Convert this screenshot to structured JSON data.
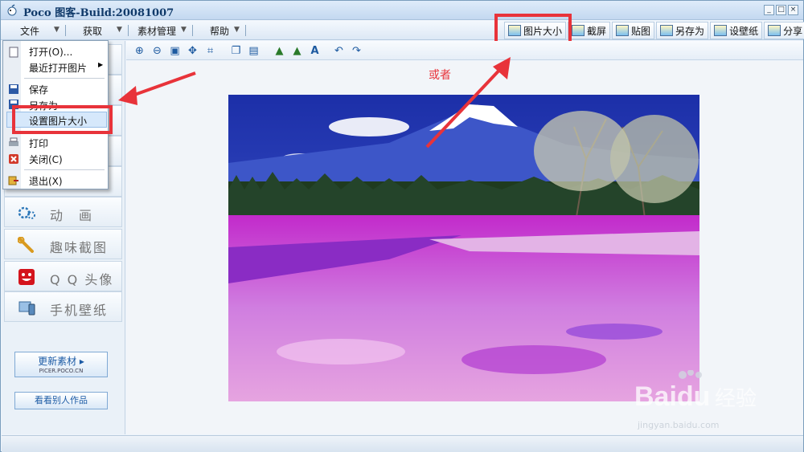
{
  "window": {
    "title": "Poco 图客-Build:20081007",
    "controls": [
      "_",
      "□",
      "×"
    ]
  },
  "menubar": {
    "items": [
      "文件",
      "获取",
      "素材管理",
      "帮助"
    ]
  },
  "toolbar_right": {
    "buttons": [
      {
        "label": "图片大小",
        "icon": "resize-icon"
      },
      {
        "label": "截屏",
        "icon": "screenshot-icon"
      },
      {
        "label": "贴图",
        "icon": "paste-icon"
      },
      {
        "label": "另存为",
        "icon": "save-as-icon"
      },
      {
        "label": "设壁纸",
        "icon": "wallpaper-icon"
      },
      {
        "label": "分享",
        "icon": "share-icon"
      }
    ]
  },
  "file_menu": {
    "items": [
      {
        "label": "打开(O)...",
        "icon": "open-icon"
      },
      {
        "label": "最近打开图片",
        "icon": ""
      },
      {
        "label": "保存",
        "icon": "save-icon"
      },
      {
        "label": "另存为",
        "icon": "save-as-icon"
      },
      {
        "label": "设置图片大小",
        "icon": ""
      },
      {
        "label": "打印",
        "icon": "print-icon"
      },
      {
        "label": "关闭(C)",
        "icon": "close-icon"
      },
      {
        "label": "退出(X)",
        "icon": "exit-icon"
      }
    ]
  },
  "sidebar": {
    "items": [
      {
        "label": "动　画",
        "icon": "gears-icon"
      },
      {
        "label": "趣味截图",
        "icon": "wrench-icon"
      },
      {
        "label": "Q Q 头像",
        "icon": "qq-face-icon"
      },
      {
        "label": "手机壁纸",
        "icon": "phone-icon"
      }
    ],
    "update_button": {
      "label": "更新素材 ▸",
      "sub": "PICER.POCO.CN"
    },
    "gallery_button": "看看别人作品"
  },
  "annotation": "或者",
  "watermark": {
    "logo": "Baidu 经验",
    "url": "jingyan.baidu.com"
  },
  "colors": {
    "highlight": "#e8333a",
    "accent": "#1c5ba5"
  }
}
